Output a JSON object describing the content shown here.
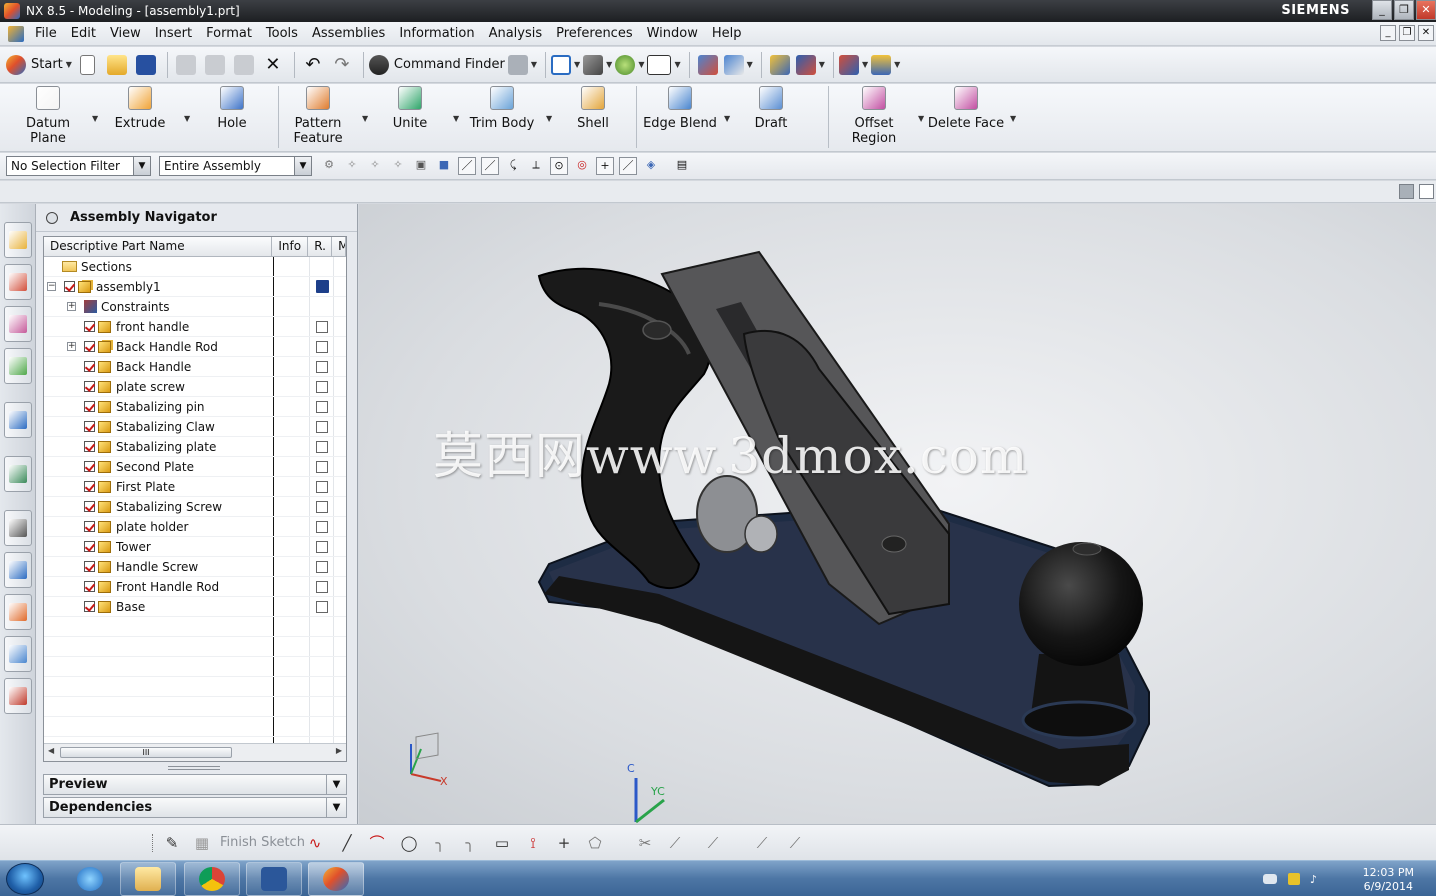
{
  "window": {
    "title": "NX 8.5 - Modeling - [assembly1.prt]",
    "brand": "SIEMENS",
    "controls": [
      "_",
      "❐",
      "✕"
    ]
  },
  "menu": {
    "items": [
      "File",
      "Edit",
      "View",
      "Insert",
      "Format",
      "Tools",
      "Assemblies",
      "Information",
      "Analysis",
      "Preferences",
      "Window",
      "Help"
    ]
  },
  "standard_toolbar": {
    "start_label": "Start",
    "command_finder_label": "Command Finder"
  },
  "ribbon": {
    "buttons": [
      {
        "label": "Datum Plane",
        "icon": "datum-plane-icon",
        "color": "#f4f4f4"
      },
      {
        "label": "Extrude",
        "icon": "extrude-icon",
        "color": "#f0a437"
      },
      {
        "label": "Hole",
        "icon": "hole-icon",
        "color": "#3f74c9"
      },
      {
        "label": "Pattern\nFeature",
        "icon": "pattern-feature-icon",
        "color": "#e07c2e"
      },
      {
        "label": "Unite",
        "icon": "unite-icon",
        "color": "#2fa66a"
      },
      {
        "label": "Trim Body",
        "icon": "trim-body-icon",
        "color": "#6aa3d8"
      },
      {
        "label": "Shell",
        "icon": "shell-icon",
        "color": "#e3a53b"
      },
      {
        "label": "Edge Blend",
        "icon": "edge-blend-icon",
        "color": "#4a86cf"
      },
      {
        "label": "Draft",
        "icon": "draft-icon",
        "color": "#5b8fd3"
      },
      {
        "label": "Offset\nRegion",
        "icon": "offset-region-icon",
        "color": "#c24fa2"
      },
      {
        "label": "Delete Face",
        "icon": "delete-face-icon",
        "color": "#c24fa2"
      }
    ]
  },
  "selection_bar": {
    "filter": "No Selection Filter",
    "scope": "Entire Assembly"
  },
  "navigator": {
    "title": "Assembly Navigator",
    "columns": [
      "Descriptive Part Name",
      "Info",
      "R.",
      "M"
    ],
    "rows": [
      {
        "name": "Sections",
        "type": "folder",
        "level": 0
      },
      {
        "name": "assembly1",
        "type": "assembly",
        "level": 0,
        "expand": "−"
      },
      {
        "name": "Constraints",
        "type": "constraints",
        "level": 1,
        "expand": "+"
      },
      {
        "name": "front handle",
        "type": "part",
        "level": 1
      },
      {
        "name": "Back Handle Rod",
        "type": "assembly",
        "level": 1,
        "expand": "+"
      },
      {
        "name": "Back Handle",
        "type": "part",
        "level": 1
      },
      {
        "name": "plate screw",
        "type": "part",
        "level": 1
      },
      {
        "name": "Stabalizing pin",
        "type": "part",
        "level": 1
      },
      {
        "name": "Stabalizing Claw",
        "type": "part",
        "level": 1
      },
      {
        "name": "Stabalizing plate",
        "type": "part",
        "level": 1
      },
      {
        "name": "Second Plate",
        "type": "part",
        "level": 1
      },
      {
        "name": "First Plate",
        "type": "part",
        "level": 1
      },
      {
        "name": "Stabalizing Screw",
        "type": "part",
        "level": 1
      },
      {
        "name": "plate holder",
        "type": "part",
        "level": 1
      },
      {
        "name": "Tower",
        "type": "part",
        "level": 1
      },
      {
        "name": "Handle Screw",
        "type": "part",
        "level": 1
      },
      {
        "name": "Front Handle Rod",
        "type": "part",
        "level": 1
      },
      {
        "name": "Base",
        "type": "part",
        "level": 1
      }
    ],
    "scroll_thumb": "III",
    "sections": [
      "Preview",
      "Dependencies"
    ]
  },
  "graphics": {
    "watermark": "莫西网www.3dmox.com",
    "csys_labels": {
      "x": "X",
      "c": "C",
      "yc": "YC"
    }
  },
  "sketch_toolbar": {
    "finish_label": "Finish Sketch"
  },
  "taskbar": {
    "time": "12:03 PM",
    "date": "6/9/2014"
  }
}
